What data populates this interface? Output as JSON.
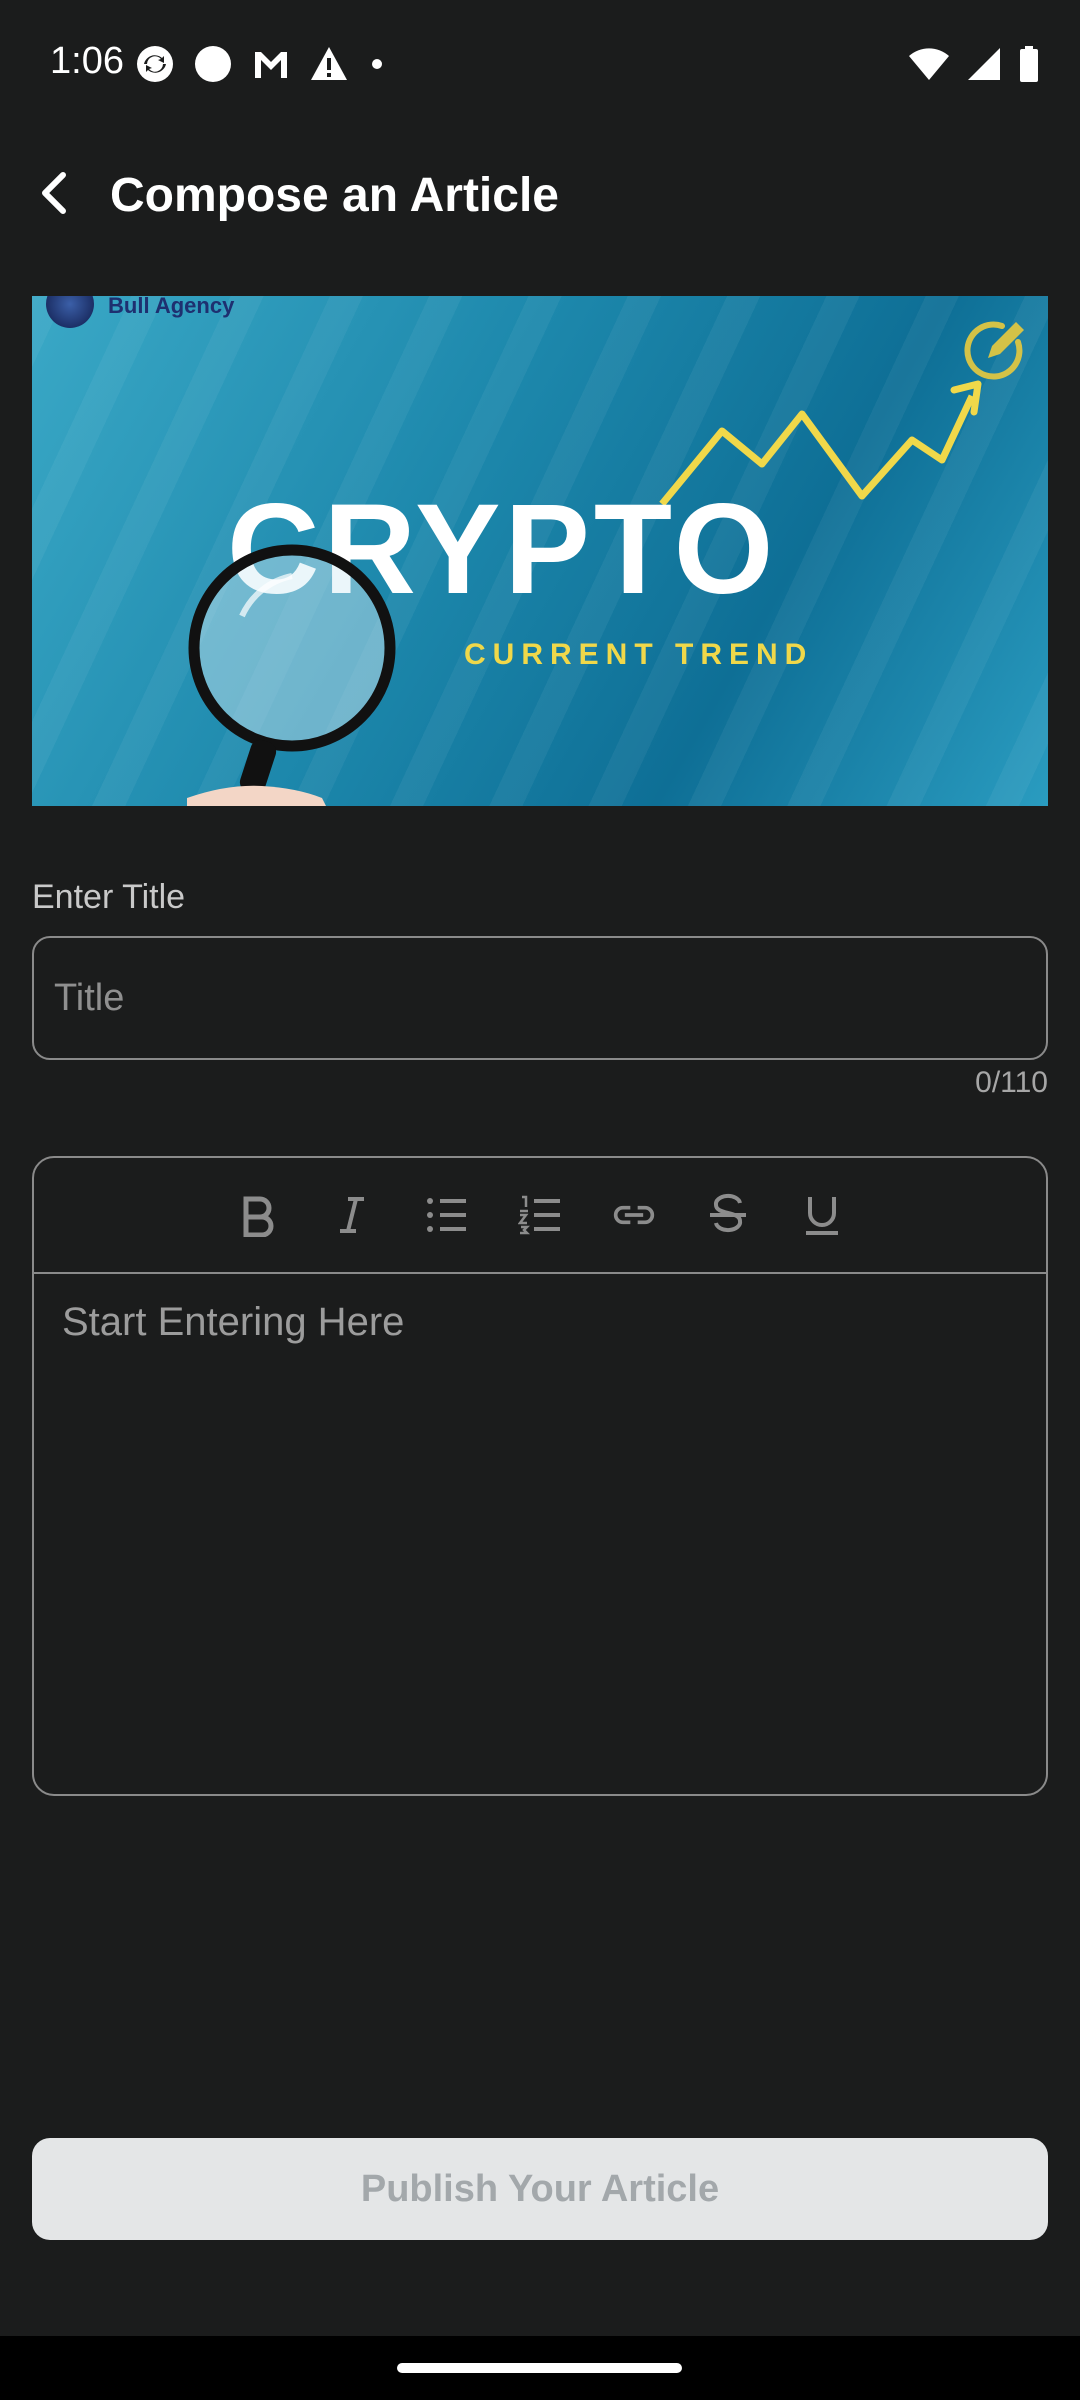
{
  "status_bar": {
    "time": "1:06",
    "left_icons": [
      "sync-icon",
      "circle-icon",
      "gmail-icon",
      "warning-icon",
      "dot-icon"
    ],
    "right_icons": [
      "wifi-icon",
      "signal-icon",
      "battery-icon"
    ]
  },
  "app_bar": {
    "title": "Compose an Article"
  },
  "cover": {
    "brand": "Bull Agency",
    "headline": "CRYPTO",
    "subheadline": "CURRENT TREND",
    "headline_color": "#ffffff",
    "subheadline_color": "#f0d84a"
  },
  "title_field": {
    "label": "Enter Title",
    "placeholder": "Title",
    "value": "",
    "counter": "0/110"
  },
  "editor": {
    "placeholder": "Start Entering Here",
    "tools": [
      "bold-icon",
      "italic-icon",
      "bulleted-list-icon",
      "numbered-list-icon",
      "link-icon",
      "strikethrough-icon",
      "underline-icon"
    ]
  },
  "publish": {
    "label": "Publish Your Article"
  },
  "colors": {
    "background": "#1b1c1c",
    "accent_yellow": "#f0d84a",
    "button_disabled_bg": "#e4e6e7",
    "button_disabled_text": "#a3a8ab"
  }
}
